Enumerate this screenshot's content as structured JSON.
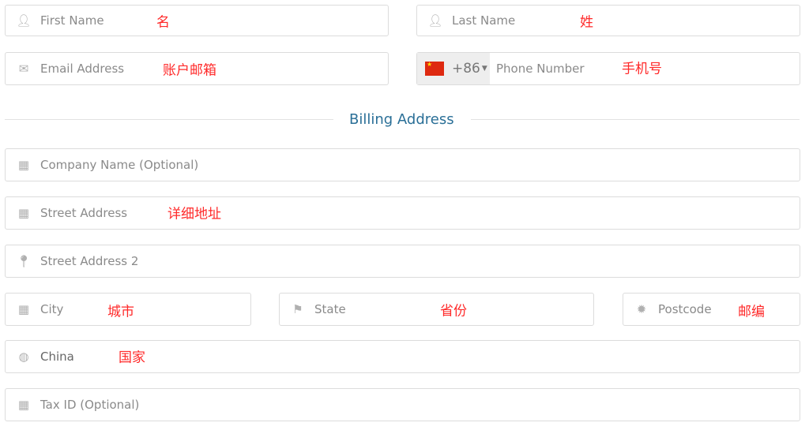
{
  "contact": {
    "first_name": {
      "placeholder": "First Name",
      "annotation": "名",
      "icon": "user-icon"
    },
    "last_name": {
      "placeholder": "Last Name",
      "annotation": "姓",
      "icon": "user-icon"
    },
    "email": {
      "placeholder": "Email Address",
      "annotation": "账户邮箱",
      "icon": "envelope-icon"
    },
    "phone": {
      "country_code": "+86",
      "placeholder": "Phone Number",
      "annotation": "手机号",
      "flag": "china-flag-icon"
    }
  },
  "billing": {
    "title": "Billing Address",
    "company": {
      "placeholder": "Company Name (Optional)",
      "icon": "building-icon"
    },
    "street": {
      "placeholder": "Street Address",
      "annotation": "详细地址",
      "icon": "building-icon"
    },
    "street2": {
      "placeholder": "Street Address 2",
      "icon": "map-marker-icon"
    },
    "city": {
      "placeholder": "City",
      "annotation": "城市",
      "icon": "building-icon"
    },
    "state": {
      "placeholder": "State",
      "annotation": "省份",
      "icon": "signpost-icon"
    },
    "postcode": {
      "placeholder": "Postcode",
      "annotation": "邮编",
      "icon": "badge-icon"
    },
    "country": {
      "value": "China",
      "annotation": "国家",
      "icon": "globe-icon"
    },
    "tax_id": {
      "placeholder": "Tax ID (Optional)",
      "icon": "building-icon"
    }
  },
  "colors": {
    "annotation": "#ff2a2a",
    "title": "#2a6f97"
  }
}
